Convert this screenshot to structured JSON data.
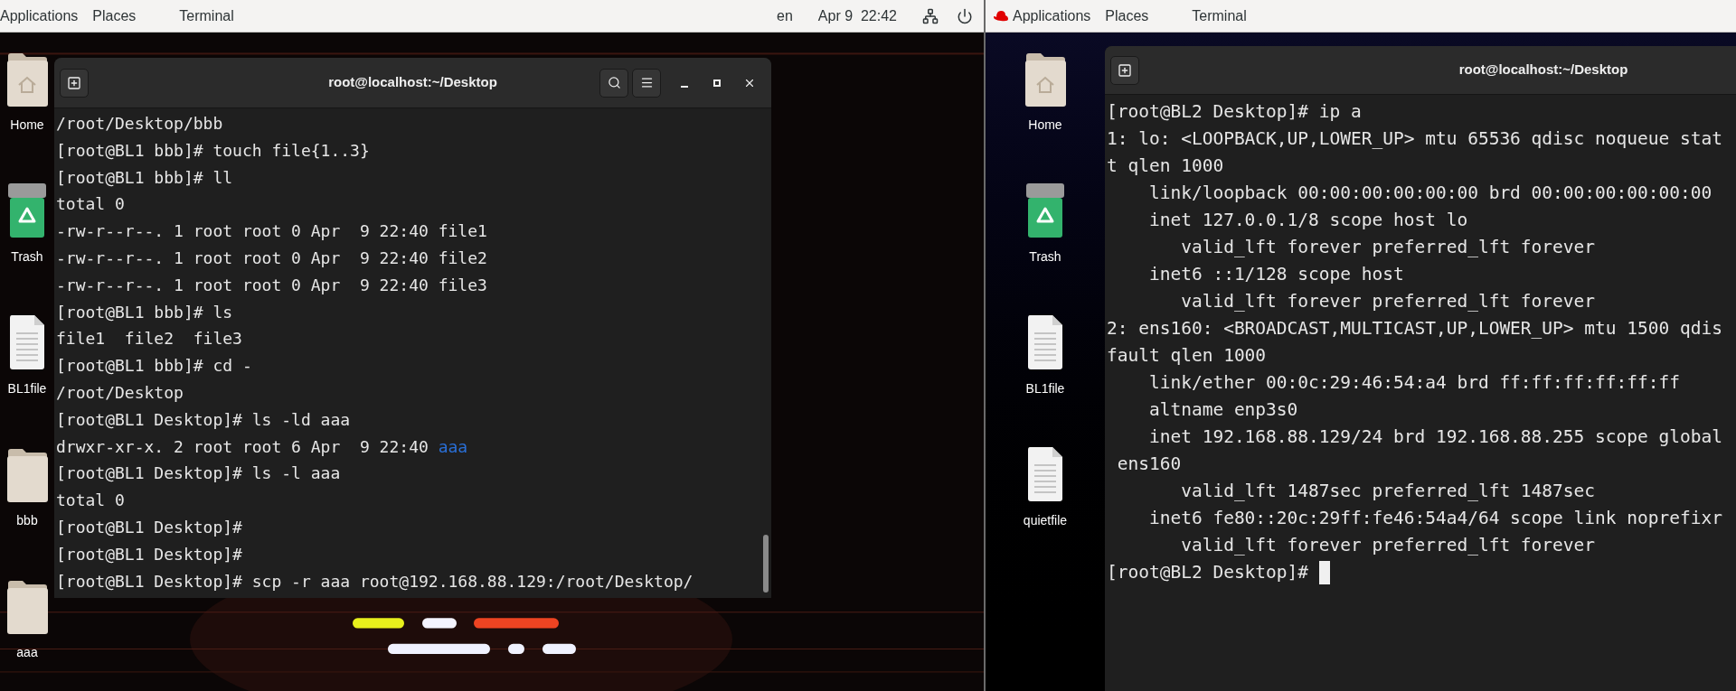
{
  "screens": [
    {
      "top_bar": {
        "logo": false,
        "menus": [
          "Applications",
          "Places",
          "Terminal"
        ],
        "status": {
          "input_source": "en",
          "clock": "Apr 9  22:42"
        }
      },
      "desktop_icons": [
        {
          "label": "Home",
          "kind": "home"
        },
        {
          "label": "Trash",
          "kind": "trash"
        },
        {
          "label": "BL1file",
          "kind": "file"
        },
        {
          "label": "bbb",
          "kind": "folder"
        },
        {
          "label": "aaa",
          "kind": "folder"
        }
      ],
      "terminal": {
        "title": "root@localhost:~/Desktop",
        "controls": true,
        "cursor": false,
        "lines": [
          "/root/Desktop/bbb",
          "[root@BL1 bbb]# touch file{1..3}",
          "[root@BL1 bbb]# ll",
          "total 0",
          "-rw-r--r--. 1 root root 0 Apr  9 22:40 file1",
          "-rw-r--r--. 1 root root 0 Apr  9 22:40 file2",
          "-rw-r--r--. 1 root root 0 Apr  9 22:40 file3",
          "[root@BL1 bbb]# ls",
          "file1  file2  file3",
          "[root@BL1 bbb]# cd -",
          "/root/Desktop",
          "[root@BL1 Desktop]# ls -ld aaa",
          [
            {
              "text": "drwxr-xr-x. 2 root root 6 Apr  9 22:40",
              "kind": "plain"
            },
            {
              "text": "aaa",
              "kind": "directory"
            }
          ],
          "[root@BL1 Desktop]# ls -l aaa",
          "total 0",
          "[root@BL1 Desktop]#",
          "[root@BL1 Desktop]#",
          "[root@BL1 Desktop]# scp -r aaa root@192.168.88.129:/root/Desktop/"
        ]
      }
    },
    {
      "top_bar": {
        "logo": true,
        "menus": [
          "Applications",
          "Places",
          "Terminal"
        ]
      },
      "desktop_icons": [
        {
          "label": "Home",
          "kind": "home"
        },
        {
          "label": "Trash",
          "kind": "trash"
        },
        {
          "label": "BL1file",
          "kind": "file"
        },
        {
          "label": "quietfile",
          "kind": "file"
        }
      ],
      "terminal": {
        "title": "root@localhost:~/Desktop",
        "controls": false,
        "cursor": true,
        "lines": [
          "[root@BL2 Desktop]# ip a",
          "1: lo: <LOOPBACK,UP,LOWER_UP> mtu 65536 qdisc noqueue stat",
          "t qlen 1000",
          "    link/loopback 00:00:00:00:00:00 brd 00:00:00:00:00:00",
          "    inet 127.0.0.1/8 scope host lo",
          "       valid_lft forever preferred_lft forever",
          "    inet6 ::1/128 scope host",
          "       valid_lft forever preferred_lft forever",
          "2: ens160: <BROADCAST,MULTICAST,UP,LOWER_UP> mtu 1500 qdis",
          "fault qlen 1000",
          "    link/ether 00:0c:29:46:54:a4 brd ff:ff:ff:ff:ff:ff",
          "    altname enp3s0",
          "    inet 192.168.88.129/24 brd 192.168.88.255 scope global",
          " ens160",
          "       valid_lft 1487sec preferred_lft 1487sec",
          "    inet6 fe80::20c:29ff:fe46:54a4/64 scope link noprefixr",
          "       valid_lft forever preferred_lft forever",
          "[root@BL2 Desktop]#"
        ]
      }
    }
  ]
}
